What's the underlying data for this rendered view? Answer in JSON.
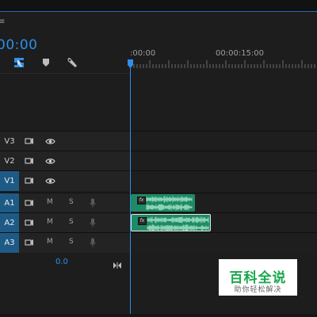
{
  "panel": {
    "menu_glyph": "≡",
    "timecode": "00:00"
  },
  "toolbar": {
    "tools": [
      {
        "name": "snap-icon"
      },
      {
        "name": "add-marker-icon"
      },
      {
        "name": "wrench-icon"
      }
    ]
  },
  "ruler": {
    "labels": [
      ":00:00",
      "00:00:15:00"
    ]
  },
  "tracks": [
    {
      "name": "V3",
      "type": "video",
      "selected": false
    },
    {
      "name": "V2",
      "type": "video",
      "selected": false
    },
    {
      "name": "V1",
      "type": "video",
      "selected": true
    },
    {
      "name": "A1",
      "type": "audio",
      "selected": true,
      "mute": "M",
      "solo": "S"
    },
    {
      "name": "A2",
      "type": "audio",
      "selected": true,
      "mute": "M",
      "solo": "S"
    },
    {
      "name": "A3",
      "type": "audio",
      "selected": true,
      "mute": "M",
      "solo": "S"
    }
  ],
  "master": {
    "value": "0.0"
  },
  "clips": [
    {
      "track": "A1",
      "fx_label": "fx",
      "color": "#1f8a65",
      "selected": false
    },
    {
      "track": "A2",
      "fx_label": "fx",
      "color": "#1f8a65",
      "selected": true
    }
  ],
  "colors": {
    "accent": "#2e8ee8",
    "selected_track": "#1e5a86",
    "audio_clip": "#1f8a65",
    "watermark": "#18a84c"
  },
  "watermark": {
    "title": "百科全说",
    "subtitle": "助你轻松解决"
  }
}
